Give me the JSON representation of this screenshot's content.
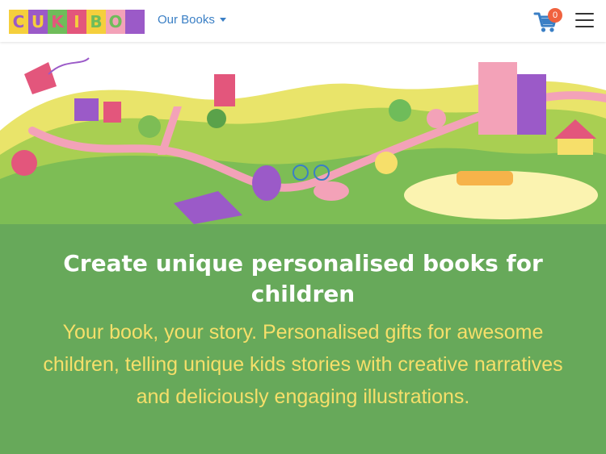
{
  "logo": {
    "letters": [
      {
        "char": "C",
        "bg": "#f5cf3c",
        "fg": "#9b5ac8"
      },
      {
        "char": "U",
        "bg": "#9b5ac8",
        "fg": "#f5cf3c"
      },
      {
        "char": "K",
        "bg": "#6fbc5a",
        "fg": "#e3567c"
      },
      {
        "char": "I",
        "bg": "#e3567c",
        "fg": "#f5cf3c"
      },
      {
        "char": "B",
        "bg": "#f5cf3c",
        "fg": "#6fbc5a"
      },
      {
        "char": "O",
        "bg": "#f3a2b8",
        "fg": "#6fbc5a"
      },
      {
        "char": "",
        "bg": "#9b5ac8",
        "fg": "#9b5ac8"
      }
    ]
  },
  "nav": {
    "books_label": "Our Books",
    "cart_count": "0"
  },
  "hero": {
    "title": "Create unique personalised books for children",
    "subtitle": "Your book, your story. Personalised gifts for awesome children, telling unique kids stories with creative narratives and deliciously engaging illustrations."
  },
  "colors": {
    "accent_green": "#67a95a",
    "subtitle_yellow": "#f6df6a",
    "link_blue": "#3a7fc5",
    "cart_badge": "#f0623e"
  }
}
